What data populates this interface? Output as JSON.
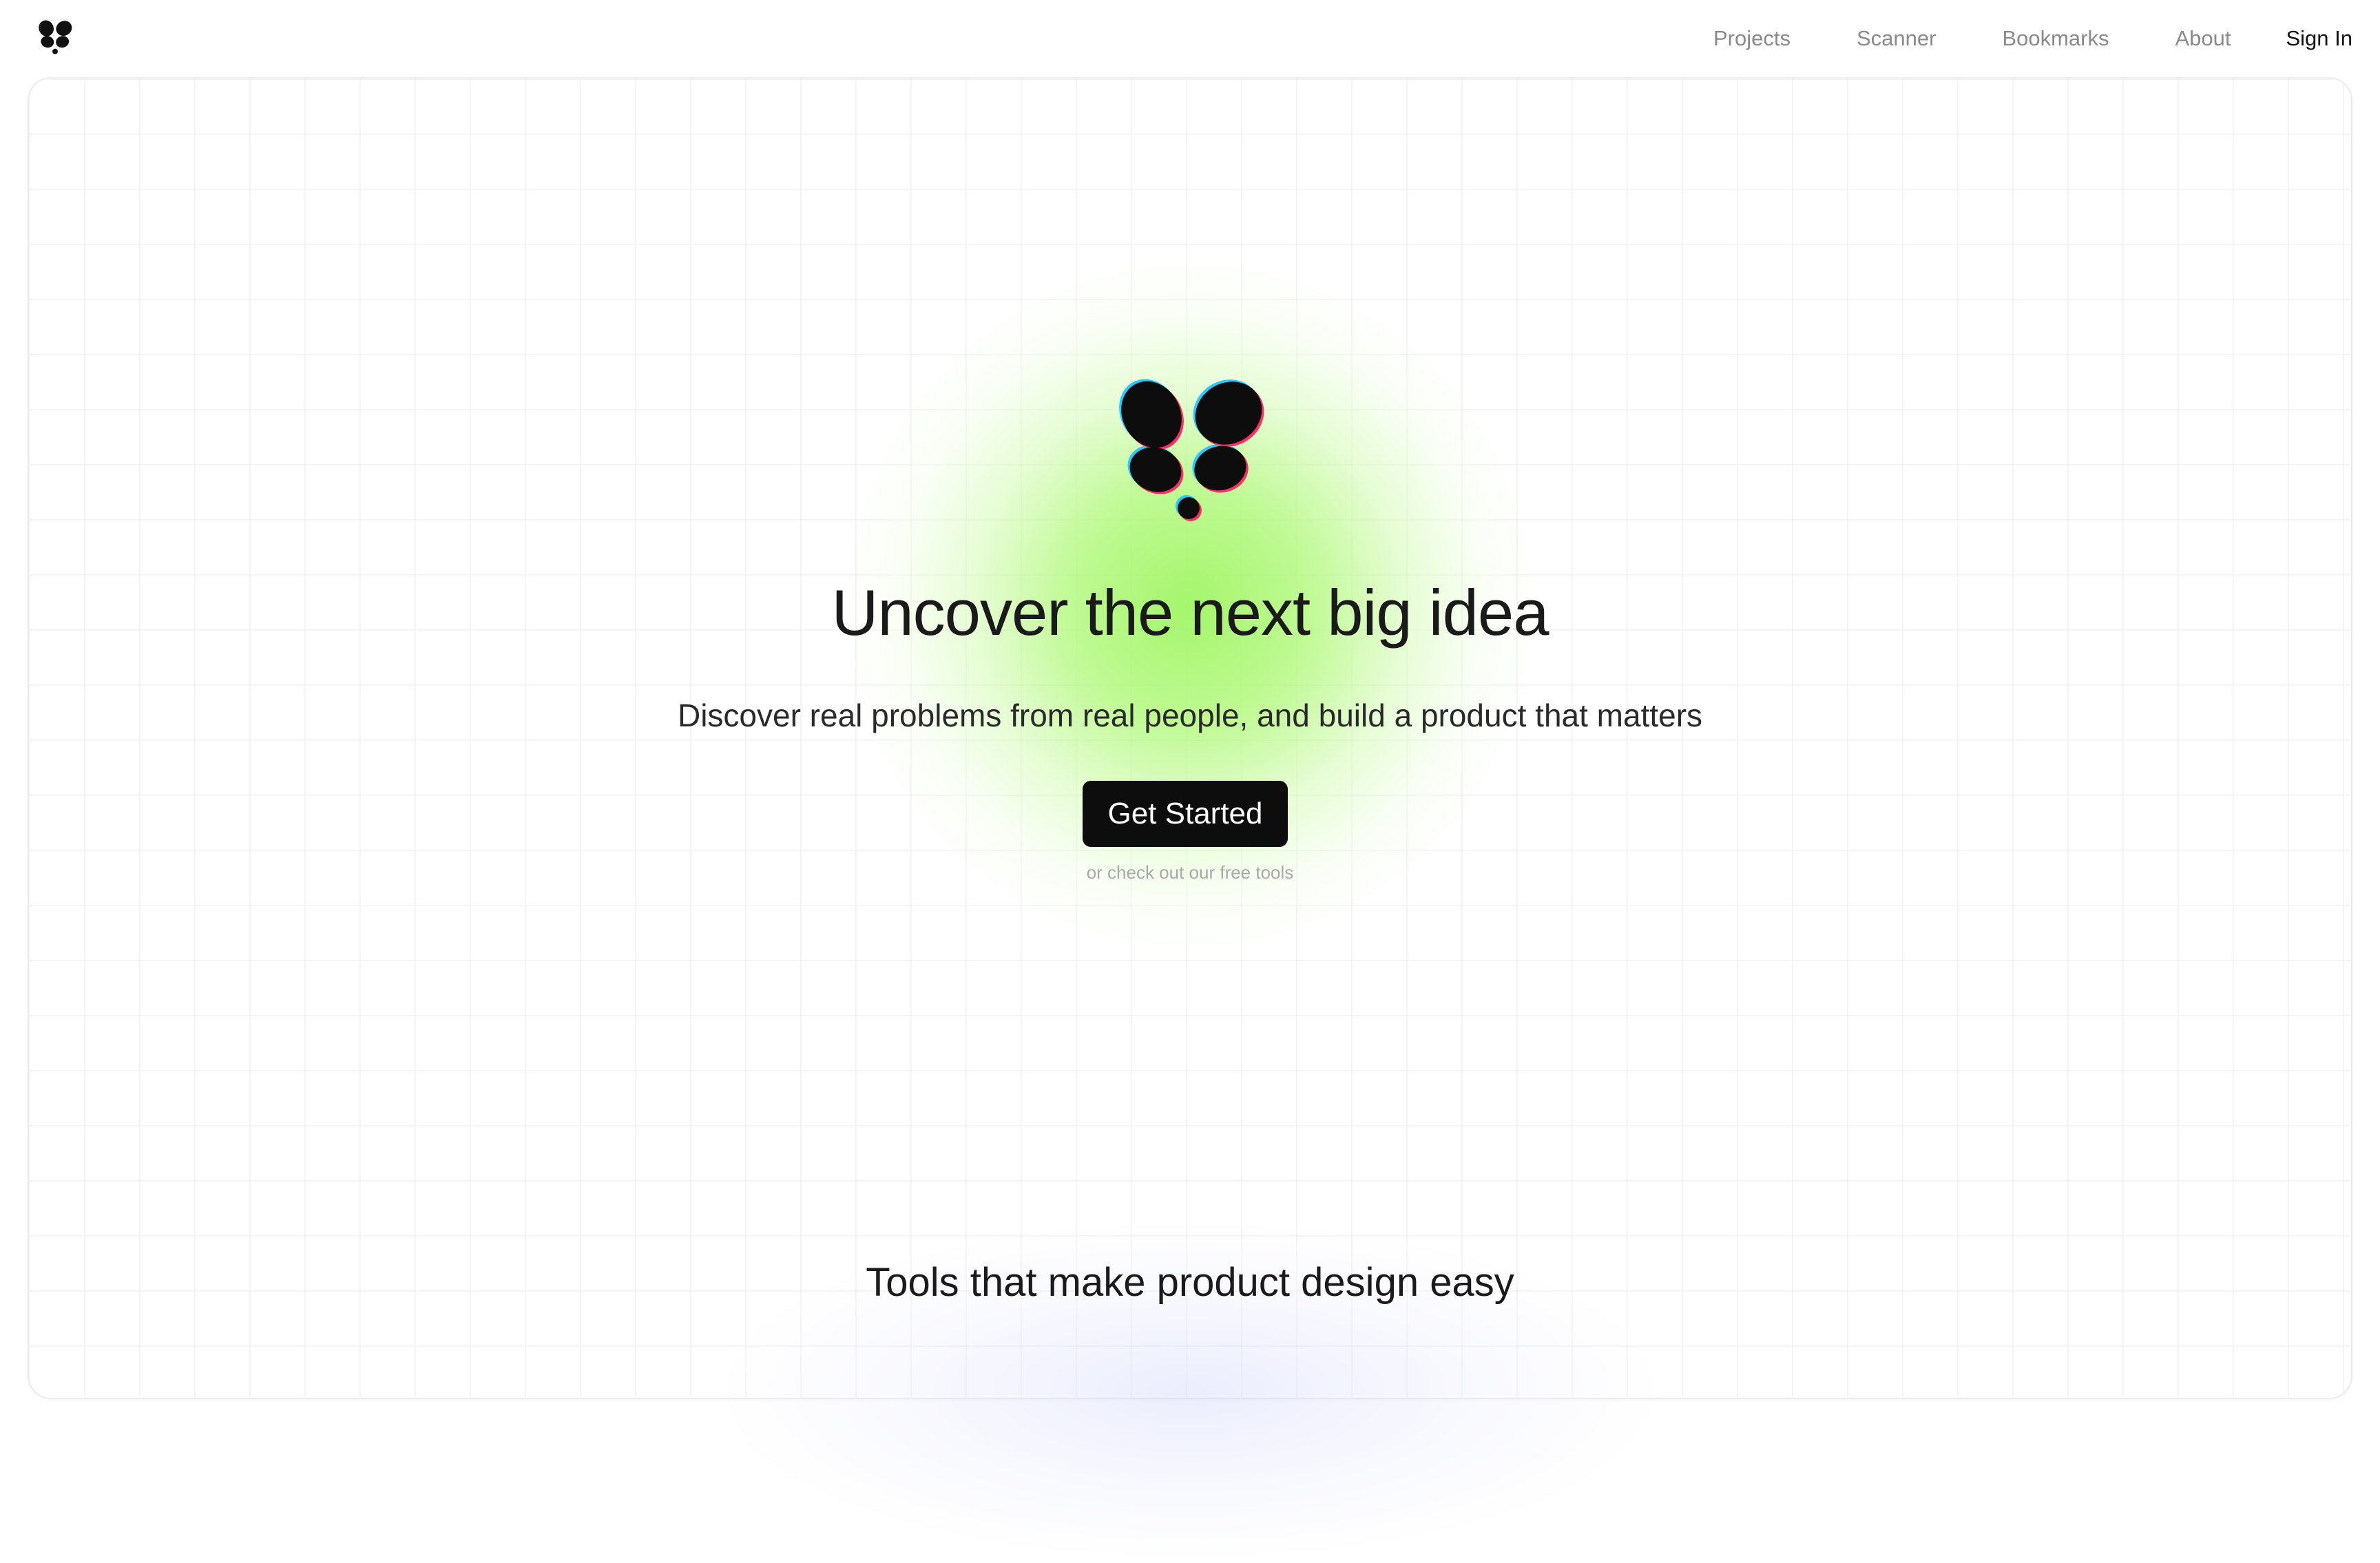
{
  "brand": {
    "logo_icon": "butterfly-logo-icon"
  },
  "nav": {
    "links": [
      {
        "label": "Projects"
      },
      {
        "label": "Scanner"
      },
      {
        "label": "Bookmarks"
      },
      {
        "label": "About"
      }
    ],
    "signin_label": "Sign In"
  },
  "hero": {
    "title": "Uncover the next big idea",
    "subtitle": "Discover real problems from real people, and build a product that matters",
    "cta_label": "Get Started",
    "secondary_link": "or check out our free tools",
    "glow_color": "#a6f56a"
  },
  "tools": {
    "title": "Tools that make product design easy"
  },
  "colors": {
    "accent": "#0d0d0d",
    "nav_text": "#8a8a8a",
    "background": "#ffffff"
  }
}
